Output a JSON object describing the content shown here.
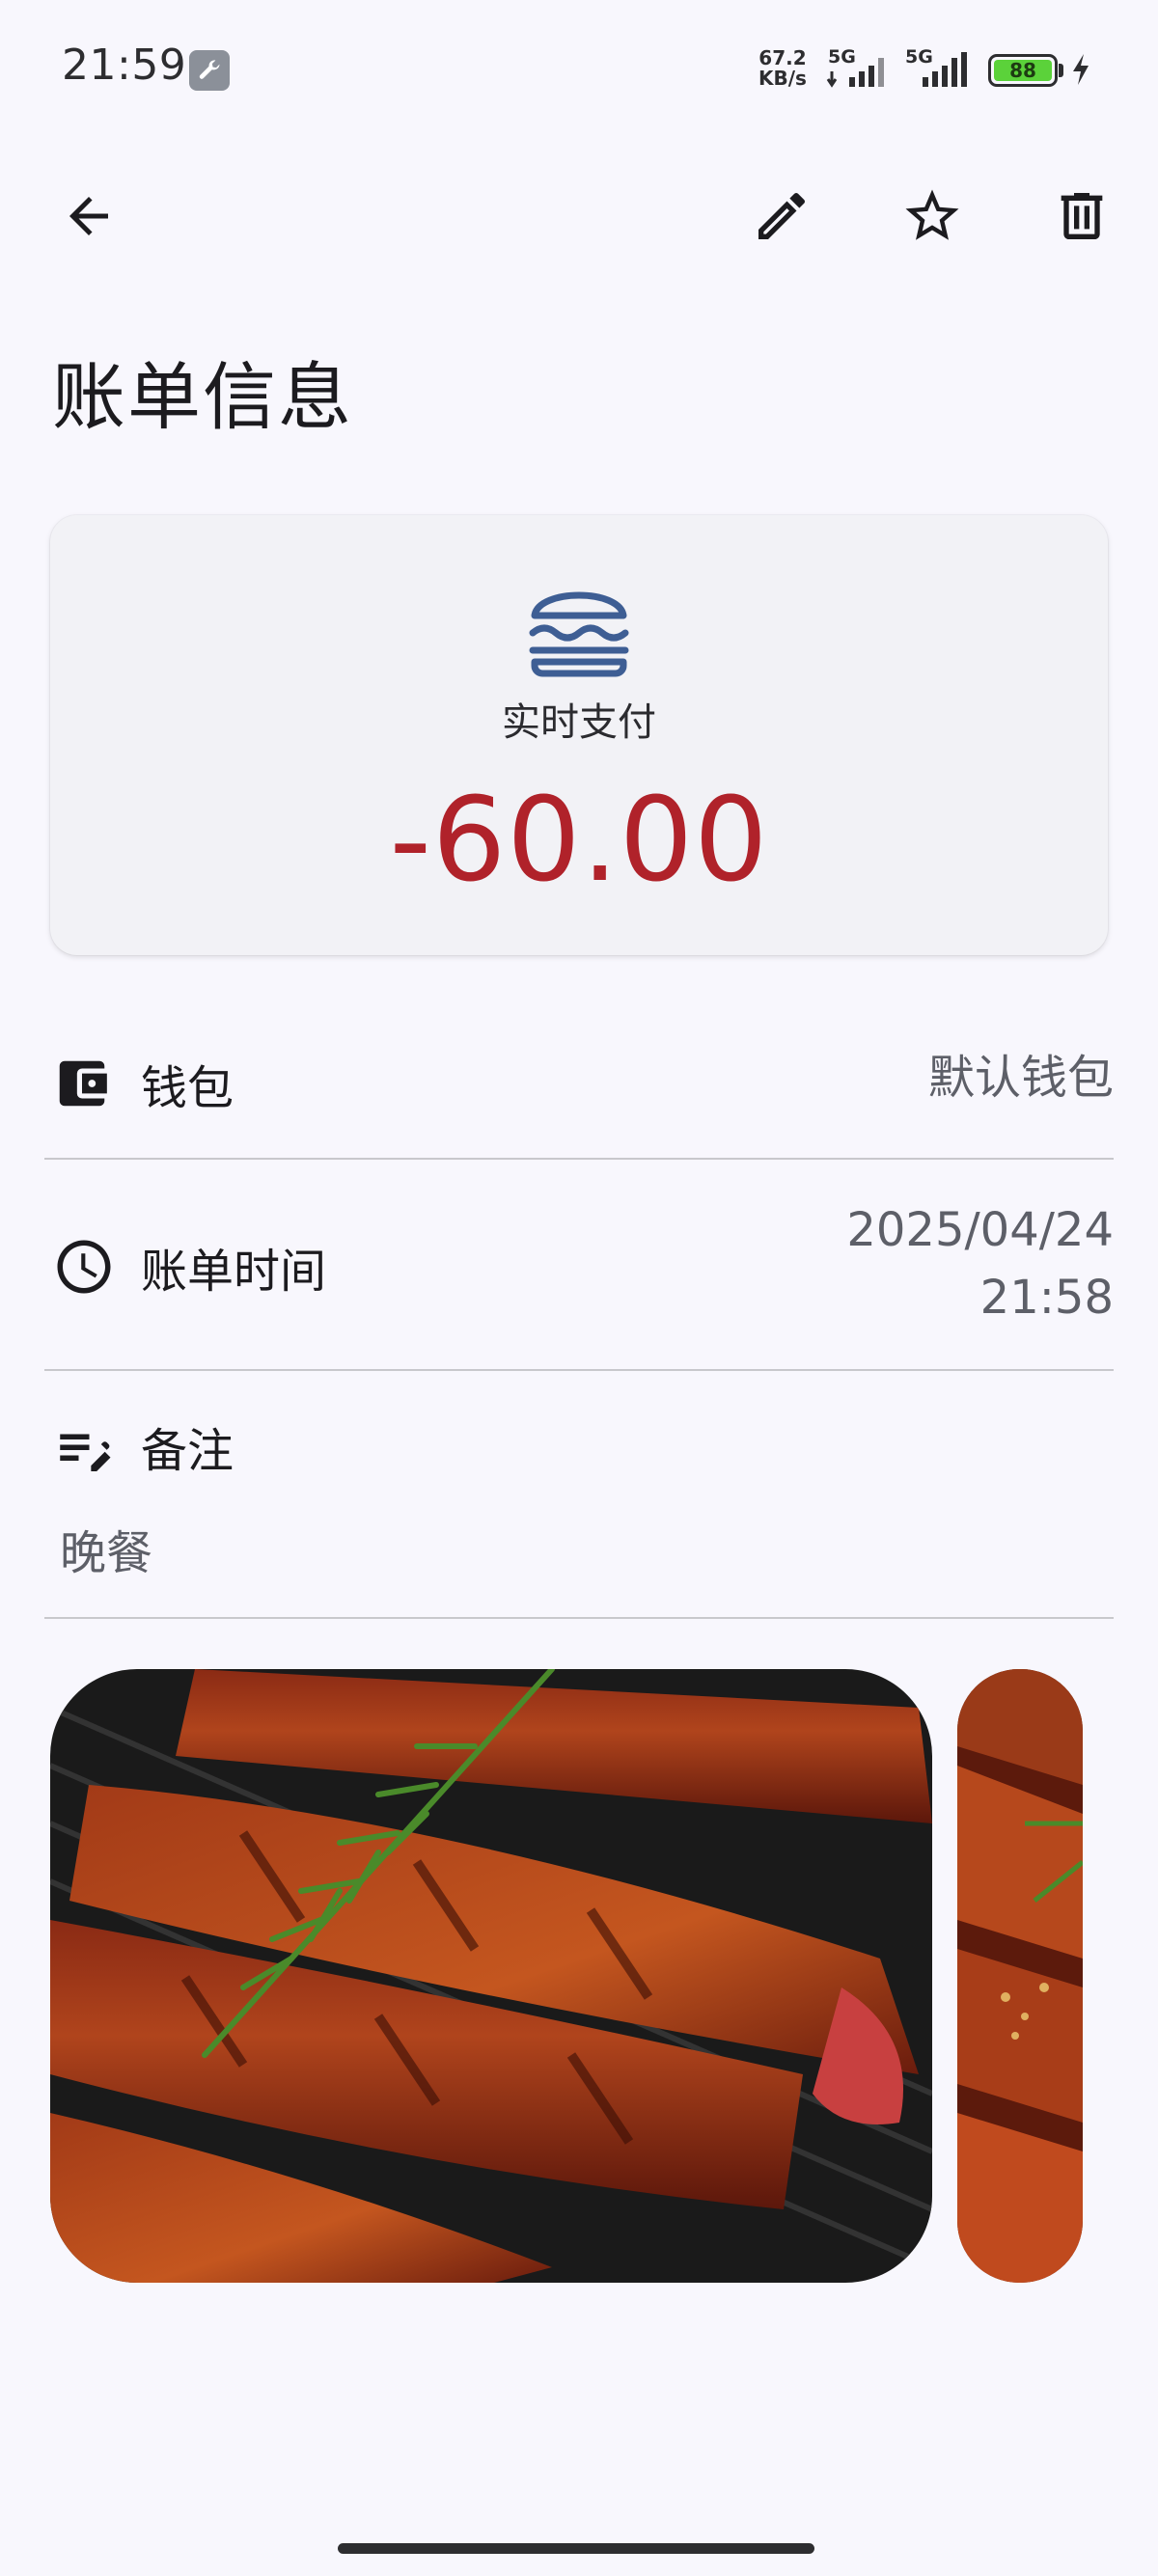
{
  "status_bar": {
    "time": "21:59",
    "net_speed_value": "67.2",
    "net_speed_unit": "KB/s",
    "sim1": "5G",
    "sim2": "5G",
    "battery": "88"
  },
  "title": "账单信息",
  "amount_card": {
    "category_icon": "hamburger-icon",
    "category_label": "实时支付",
    "amount": "-60.00",
    "amount_color": "#b0222a"
  },
  "wallet": {
    "label": "钱包",
    "value": "默认钱包"
  },
  "bill_time": {
    "label": "账单时间",
    "date": "2025/04/24",
    "time": "21:58"
  },
  "note": {
    "label": "备注",
    "text": "晚餐"
  },
  "photos": {
    "main": "grilled-steak-photo",
    "side": "grilled-steak-photo-2"
  }
}
